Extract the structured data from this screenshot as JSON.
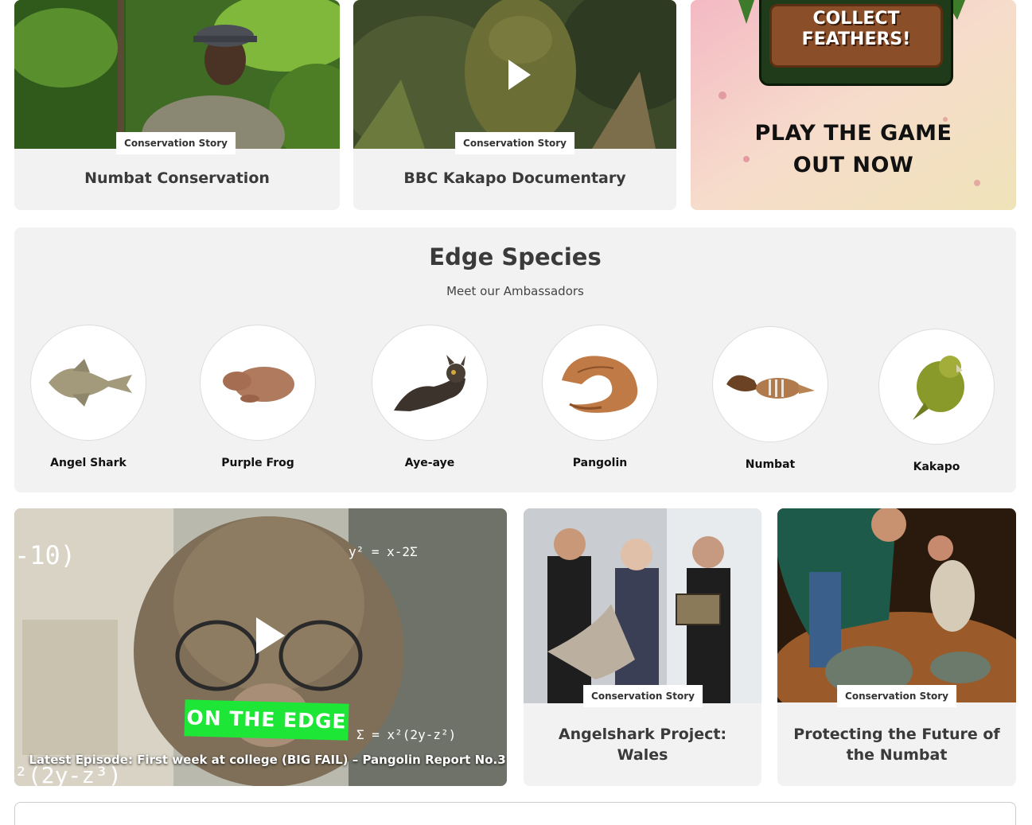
{
  "top_cards": [
    {
      "tag": "Conservation Story",
      "title": "Numbat Conservation"
    },
    {
      "tag": "Conservation Story",
      "title": "BBC Kakapo Documentary"
    }
  ],
  "game_promo": {
    "badge_line1": "COLLECT",
    "badge_line2": "FEATHERS!",
    "title_line1": "PLAY THE GAME",
    "title_line2": "OUT NOW"
  },
  "species": {
    "title": "Edge Species",
    "subtitle": "Meet our Ambassadors",
    "items": [
      {
        "name": "Angel Shark",
        "icon": "angel-shark-icon"
      },
      {
        "name": "Purple Frog",
        "icon": "purple-frog-icon"
      },
      {
        "name": "Aye-aye",
        "icon": "aye-aye-icon"
      },
      {
        "name": "Pangolin",
        "icon": "pangolin-icon"
      },
      {
        "name": "Numbat",
        "icon": "numbat-icon"
      },
      {
        "name": "Kakapo",
        "icon": "kakapo-icon"
      }
    ]
  },
  "episode": {
    "badge": "ON THE EDGE",
    "caption": "Latest Episode: First week at college (BIG FAIL) – Pangolin Report No.3"
  },
  "bottom_cards": [
    {
      "tag": "Conservation Story",
      "title": "Angelshark Project: Wales"
    },
    {
      "tag": "Conservation Story",
      "title": "Protecting the Future of the Numbat"
    }
  ],
  "colors": {
    "panel": "#f2f2f2",
    "on_edge_green": "#1ee636",
    "text": "#3a3a3a"
  }
}
